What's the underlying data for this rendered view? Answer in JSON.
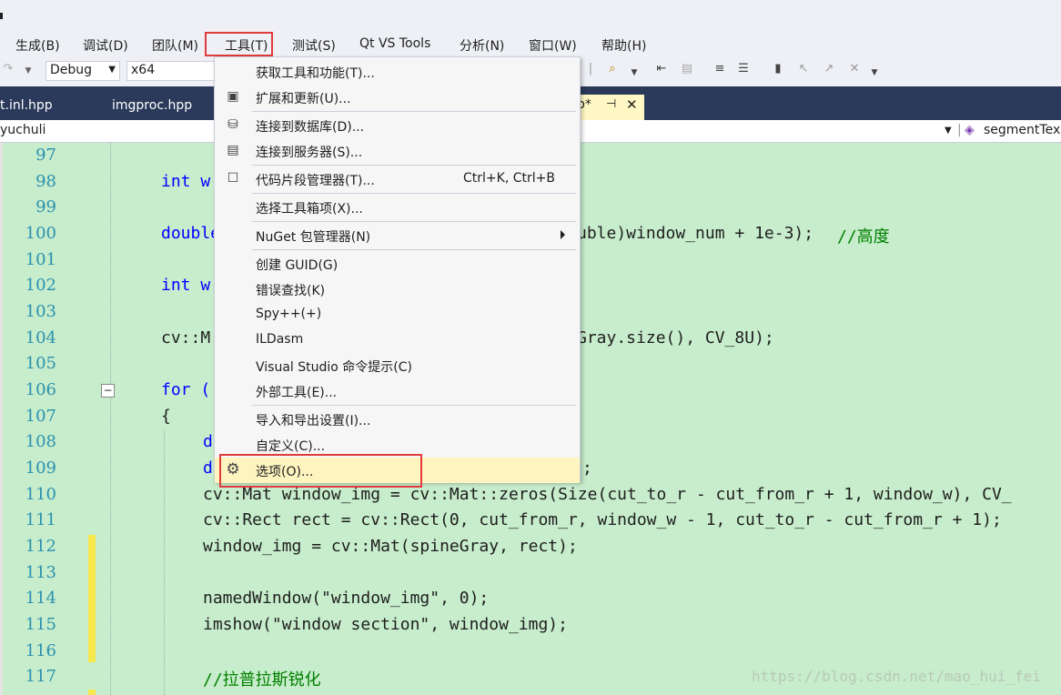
{
  "menubar": {
    "items": [
      "生成(B)",
      "调试(D)",
      "团队(M)",
      "工具(T)",
      "测试(S)",
      "Qt VS Tools",
      "分析(N)",
      "窗口(W)",
      "帮助(H)"
    ]
  },
  "toolbar": {
    "config_value": "Debug",
    "platform_value": "x64"
  },
  "tabs": [
    "t.inl.hpp",
    "imgproc.hpp",
    "p*"
  ],
  "navbar": {
    "project_value": "yuchuli",
    "member_value": "segmentTex"
  },
  "tools_menu": {
    "items": [
      {
        "label": "获取工具和功能(T)...",
        "icon": "none"
      },
      {
        "label": "扩展和更新(U)...",
        "icon": "extensions-icon"
      },
      {
        "label": "连接到数据库(D)...",
        "icon": "database-connect-icon"
      },
      {
        "label": "连接到服务器(S)...",
        "icon": "server-connect-icon"
      },
      {
        "label": "代码片段管理器(T)...",
        "icon": "snippet-icon",
        "shortcut": "Ctrl+K, Ctrl+B"
      },
      {
        "label": "选择工具箱项(X)...",
        "icon": "none"
      },
      {
        "label": "NuGet 包管理器(N)",
        "icon": "none",
        "submenu": true
      },
      {
        "label": "创建 GUID(G)",
        "icon": "none"
      },
      {
        "label": "错误查找(K)",
        "icon": "none"
      },
      {
        "label": "Spy++(+)",
        "icon": "none"
      },
      {
        "label": "ILDasm",
        "icon": "none"
      },
      {
        "label": "Visual Studio 命令提示(C)",
        "icon": "none"
      },
      {
        "label": "外部工具(E)...",
        "icon": "none"
      },
      {
        "label": "导入和导出设置(I)...",
        "icon": "none"
      },
      {
        "label": "自定义(C)...",
        "icon": "none"
      },
      {
        "label": "选项(O)...",
        "icon": "gear-icon",
        "highlighted": true
      }
    ]
  },
  "editor": {
    "line_numbers": [
      "97",
      "98",
      "99",
      "100",
      "101",
      "102",
      "103",
      "104",
      "105",
      "106",
      "107",
      "108",
      "109",
      "110",
      "111",
      "112",
      "113",
      "114",
      "115",
      "116",
      "117"
    ],
    "line_98": "int w",
    "line_100_a": "double",
    "line_100_b": "uble)window_num + 1e-3);",
    "line_100_comment": "//高度",
    "line_102": "int w",
    "line_104_a": "cv::M",
    "line_104_b": "Gray.size(), CV_8U);",
    "line_106": "for (",
    "line_107": "{",
    "line_108": "d",
    "line_109_a": "d",
    "line_109_b": ";",
    "line_110": "cv::Mat window_img = cv::Mat::zeros(Size(cut_to_r - cut_from_r + 1, window_w), CV_",
    "line_111": "cv::Rect rect = cv::Rect(0, cut_from_r, window_w - 1, cut_to_r - cut_from_r + 1);",
    "line_112": "window_img = cv::Mat(spineGray, rect);",
    "line_114": "namedWindow(\"window_img\", 0);",
    "line_115": "imshow(\"window section\", window_img);",
    "line_117": "//拉普拉斯锐化"
  },
  "watermark": "https://blog.csdn.net/mao_hui_fei"
}
